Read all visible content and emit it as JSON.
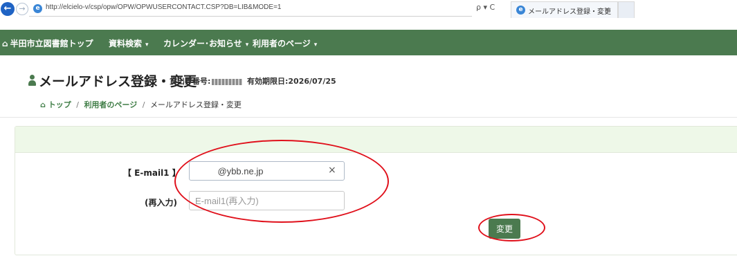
{
  "browser": {
    "url": "http://elcielo-v/csp/opw/OPW/OPWUSERCONTACT.CSP?DB=LIB&MODE=1",
    "tools": "ρ ▾ C",
    "tab_title": "メールアドレス登録・変更",
    "tab_close": "×"
  },
  "navbar": {
    "home": "半田市立図書館トップ",
    "items": [
      {
        "label": "資料検索"
      },
      {
        "label": "カレンダー･お知らせ"
      },
      {
        "label": "利用者のページ"
      }
    ]
  },
  "heading": {
    "title": "メールアドレス登録・変更",
    "card_label": "貸出券番号:",
    "expiry": "有効期限日:2026/07/25"
  },
  "breadcrumb": {
    "top": "トップ",
    "sep": "/",
    "user_page": "利用者のページ",
    "current": "メールアドレス登録・変更"
  },
  "form": {
    "email_label": "【 E-mail1 】",
    "email_value": "         @ybb.ne.jp",
    "reenter_label": "(再入力)",
    "reenter_placeholder": "E-mail1(再入力)",
    "submit_label": "変更"
  },
  "colors": {
    "nav_green": "#4b7a4f",
    "panel_header": "#eef8e8",
    "annotation_red": "#e0101b"
  }
}
